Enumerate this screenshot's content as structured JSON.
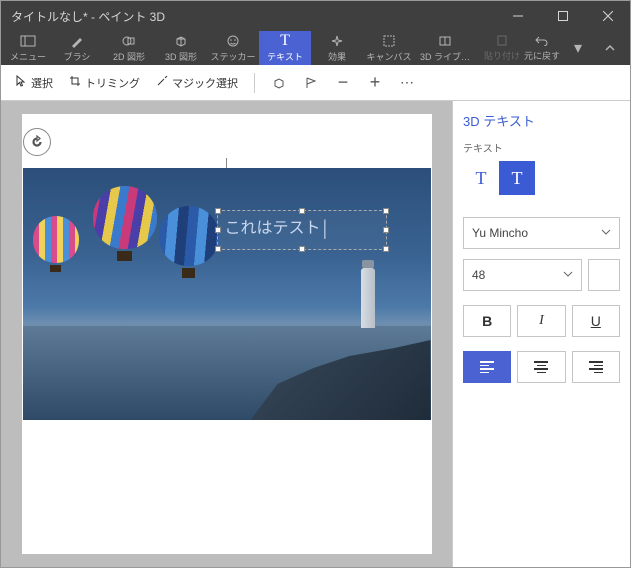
{
  "window": {
    "title": "タイトルなし* - ペイント 3D"
  },
  "ribbon": {
    "menu": "メニュー",
    "brush": "ブラシ",
    "shape2d": "2D 図形",
    "shape3d": "3D 図形",
    "sticker": "ステッカー",
    "text": "テキスト",
    "effects": "効果",
    "canvas": "キャンバス",
    "lib3d": "3D ライブ…",
    "paste": "貼り付け",
    "undo": "元に戻す"
  },
  "toolbar": {
    "select": "選択",
    "trim": "トリミング",
    "magic": "マジック選択"
  },
  "canvas": {
    "text_value": "これはテスト"
  },
  "side": {
    "title": "3D テキスト",
    "section_label": "テキスト",
    "font": "Yu Mincho",
    "size": "48",
    "color": "#ffffff"
  },
  "icons": {
    "select_glyph": "⟡"
  }
}
